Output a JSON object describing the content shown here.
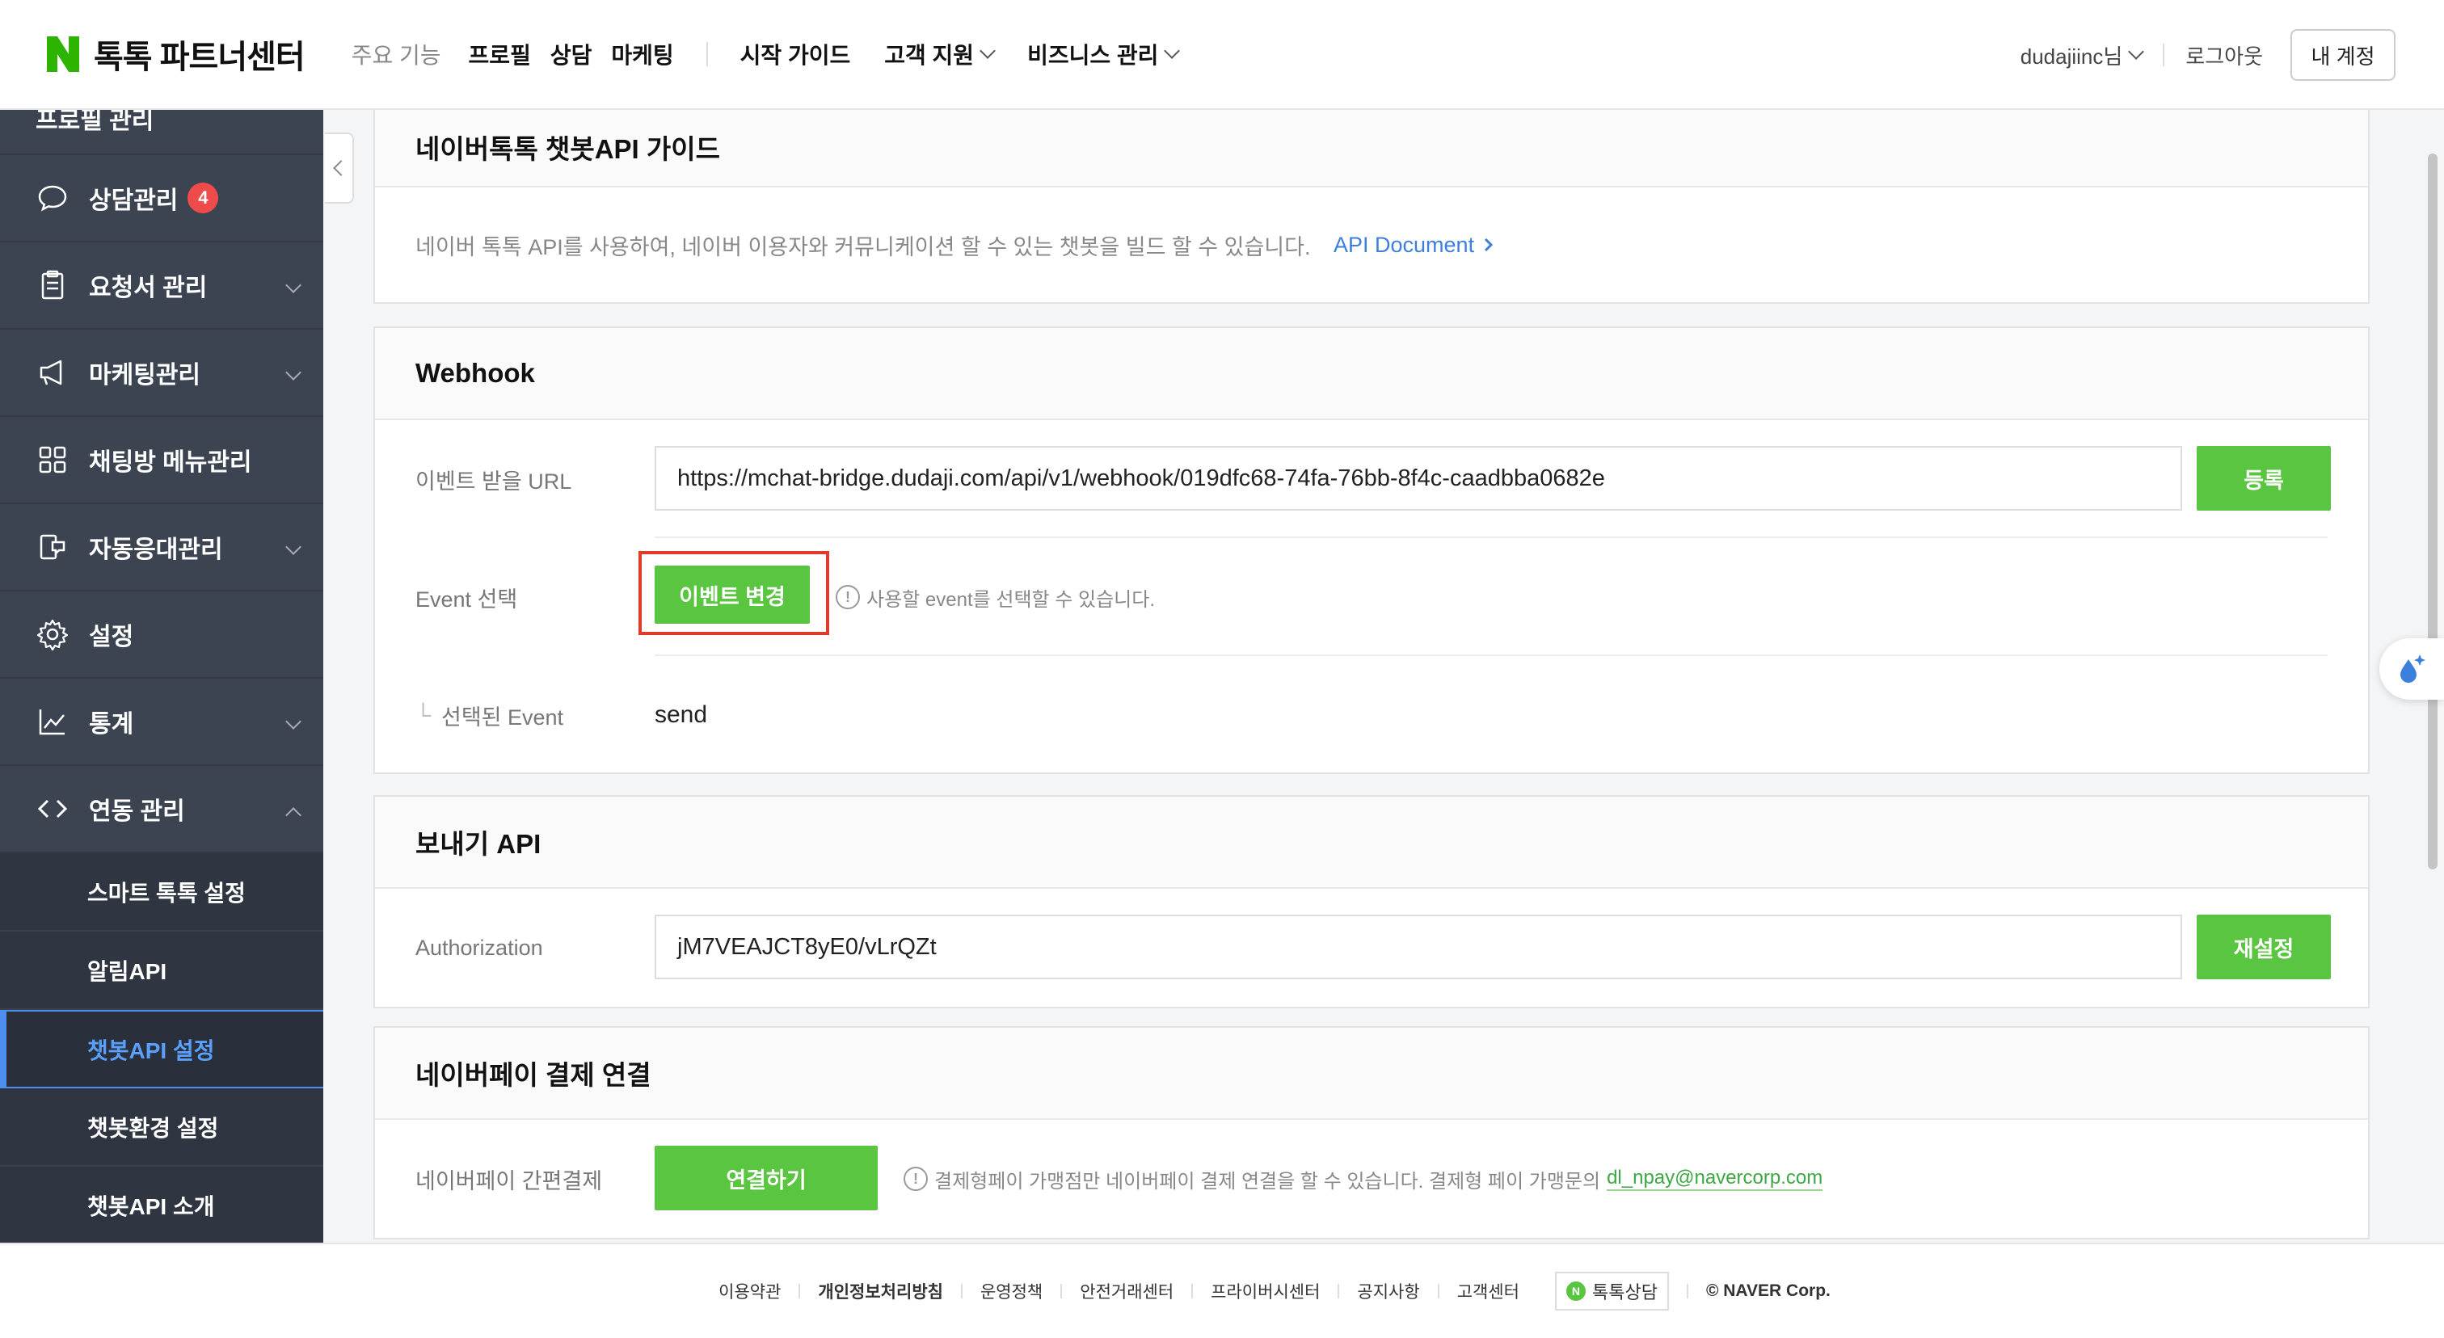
{
  "header": {
    "logo_text": "톡톡 파트너센터",
    "nav_muted": "주요 기능",
    "nav_items": [
      "프로필",
      "상담",
      "마케팅"
    ],
    "nav_guide": "시작 가이드",
    "nav_support": "고객 지원",
    "nav_business": "비즈니스 관리",
    "user": "dudajiinc님",
    "logout": "로그아웃",
    "account": "내 계정"
  },
  "sidebar": {
    "top_partial": "프로필 관리",
    "items": [
      {
        "label": "상담관리",
        "badge": "4"
      },
      {
        "label": "요청서 관리"
      },
      {
        "label": "마케팅관리"
      },
      {
        "label": "채팅방 메뉴관리"
      },
      {
        "label": "자동응대관리"
      },
      {
        "label": "설정"
      },
      {
        "label": "통계"
      },
      {
        "label": "연동 관리"
      }
    ],
    "sub_items": [
      "스마트 톡톡 설정",
      "알림API",
      "챗봇API 설정",
      "챗봇환경 설정",
      "챗봇API 소개"
    ]
  },
  "guide": {
    "title": "네이버톡톡 챗봇API 가이드",
    "description": "네이버 톡톡 API를 사용하여, 네이버 이용자와 커뮤니케이션 할 수 있는 챗봇을 빌드 할 수 있습니다.",
    "link": "API Document"
  },
  "webhook": {
    "title": "Webhook",
    "url_label": "이벤트 받을 URL",
    "url_value": "https://mchat-bridge.dudaji.com/api/v1/webhook/019dfc68-74fa-76bb-8f4c-caadbba0682e",
    "register": "등록",
    "event_label": "Event 선택",
    "event_button": "이벤트 변경",
    "event_hint": "사용할 event를 선택할 수 있습니다.",
    "selected_label": "선택된 Event",
    "selected_value": "send"
  },
  "send_api": {
    "title": "보내기 API",
    "auth_label": "Authorization",
    "auth_value": "jM7VEAJCT8yE0/vLrQZt",
    "reset": "재설정"
  },
  "npay": {
    "title": "네이버페이 결제 연결",
    "label": "네이버페이 간편결제",
    "button": "연결하기",
    "hint": "결제형페이 가맹점만 네이버페이 결제 연결을 할 수 있습니다. 결제형 페이 가맹문의",
    "email": "dl_npay@navercorp.com"
  },
  "footer": {
    "links": [
      "이용약관",
      "개인정보처리방침",
      "운영정책",
      "안전거래센터",
      "프라이버시센터",
      "공지사항",
      "고객센터"
    ],
    "talk": "톡톡상담",
    "copyright": "© NAVER Corp."
  },
  "colors": {
    "brand_green": "#5ac541",
    "sidebar_bg": "#3c4452",
    "active_blue": "#5aa0ff",
    "highlight_red": "#e13b2c"
  }
}
